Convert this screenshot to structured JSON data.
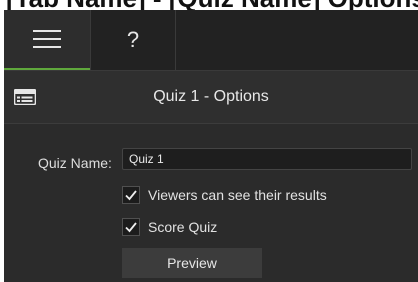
{
  "breadcrumb_fragment": "[Tab Name] - [Quiz Name] Options",
  "tabs": [
    {
      "id": "options",
      "icon": "hamburger-icon",
      "label": ""
    },
    {
      "id": "help",
      "icon": "question-icon",
      "label": "?"
    }
  ],
  "panel": {
    "title": "Quiz 1 - Options",
    "icon": "properties-icon"
  },
  "form": {
    "quiz_name_label": "Quiz Name:",
    "quiz_name_value": "Quiz 1",
    "checkbox_results_label": "Viewers can see their results",
    "checkbox_results_checked": true,
    "checkbox_score_label": "Score Quiz",
    "checkbox_score_checked": true,
    "preview_label": "Preview"
  },
  "colors": {
    "accent_green": "#5fa83c",
    "panel_bg": "#2b2b2b"
  }
}
